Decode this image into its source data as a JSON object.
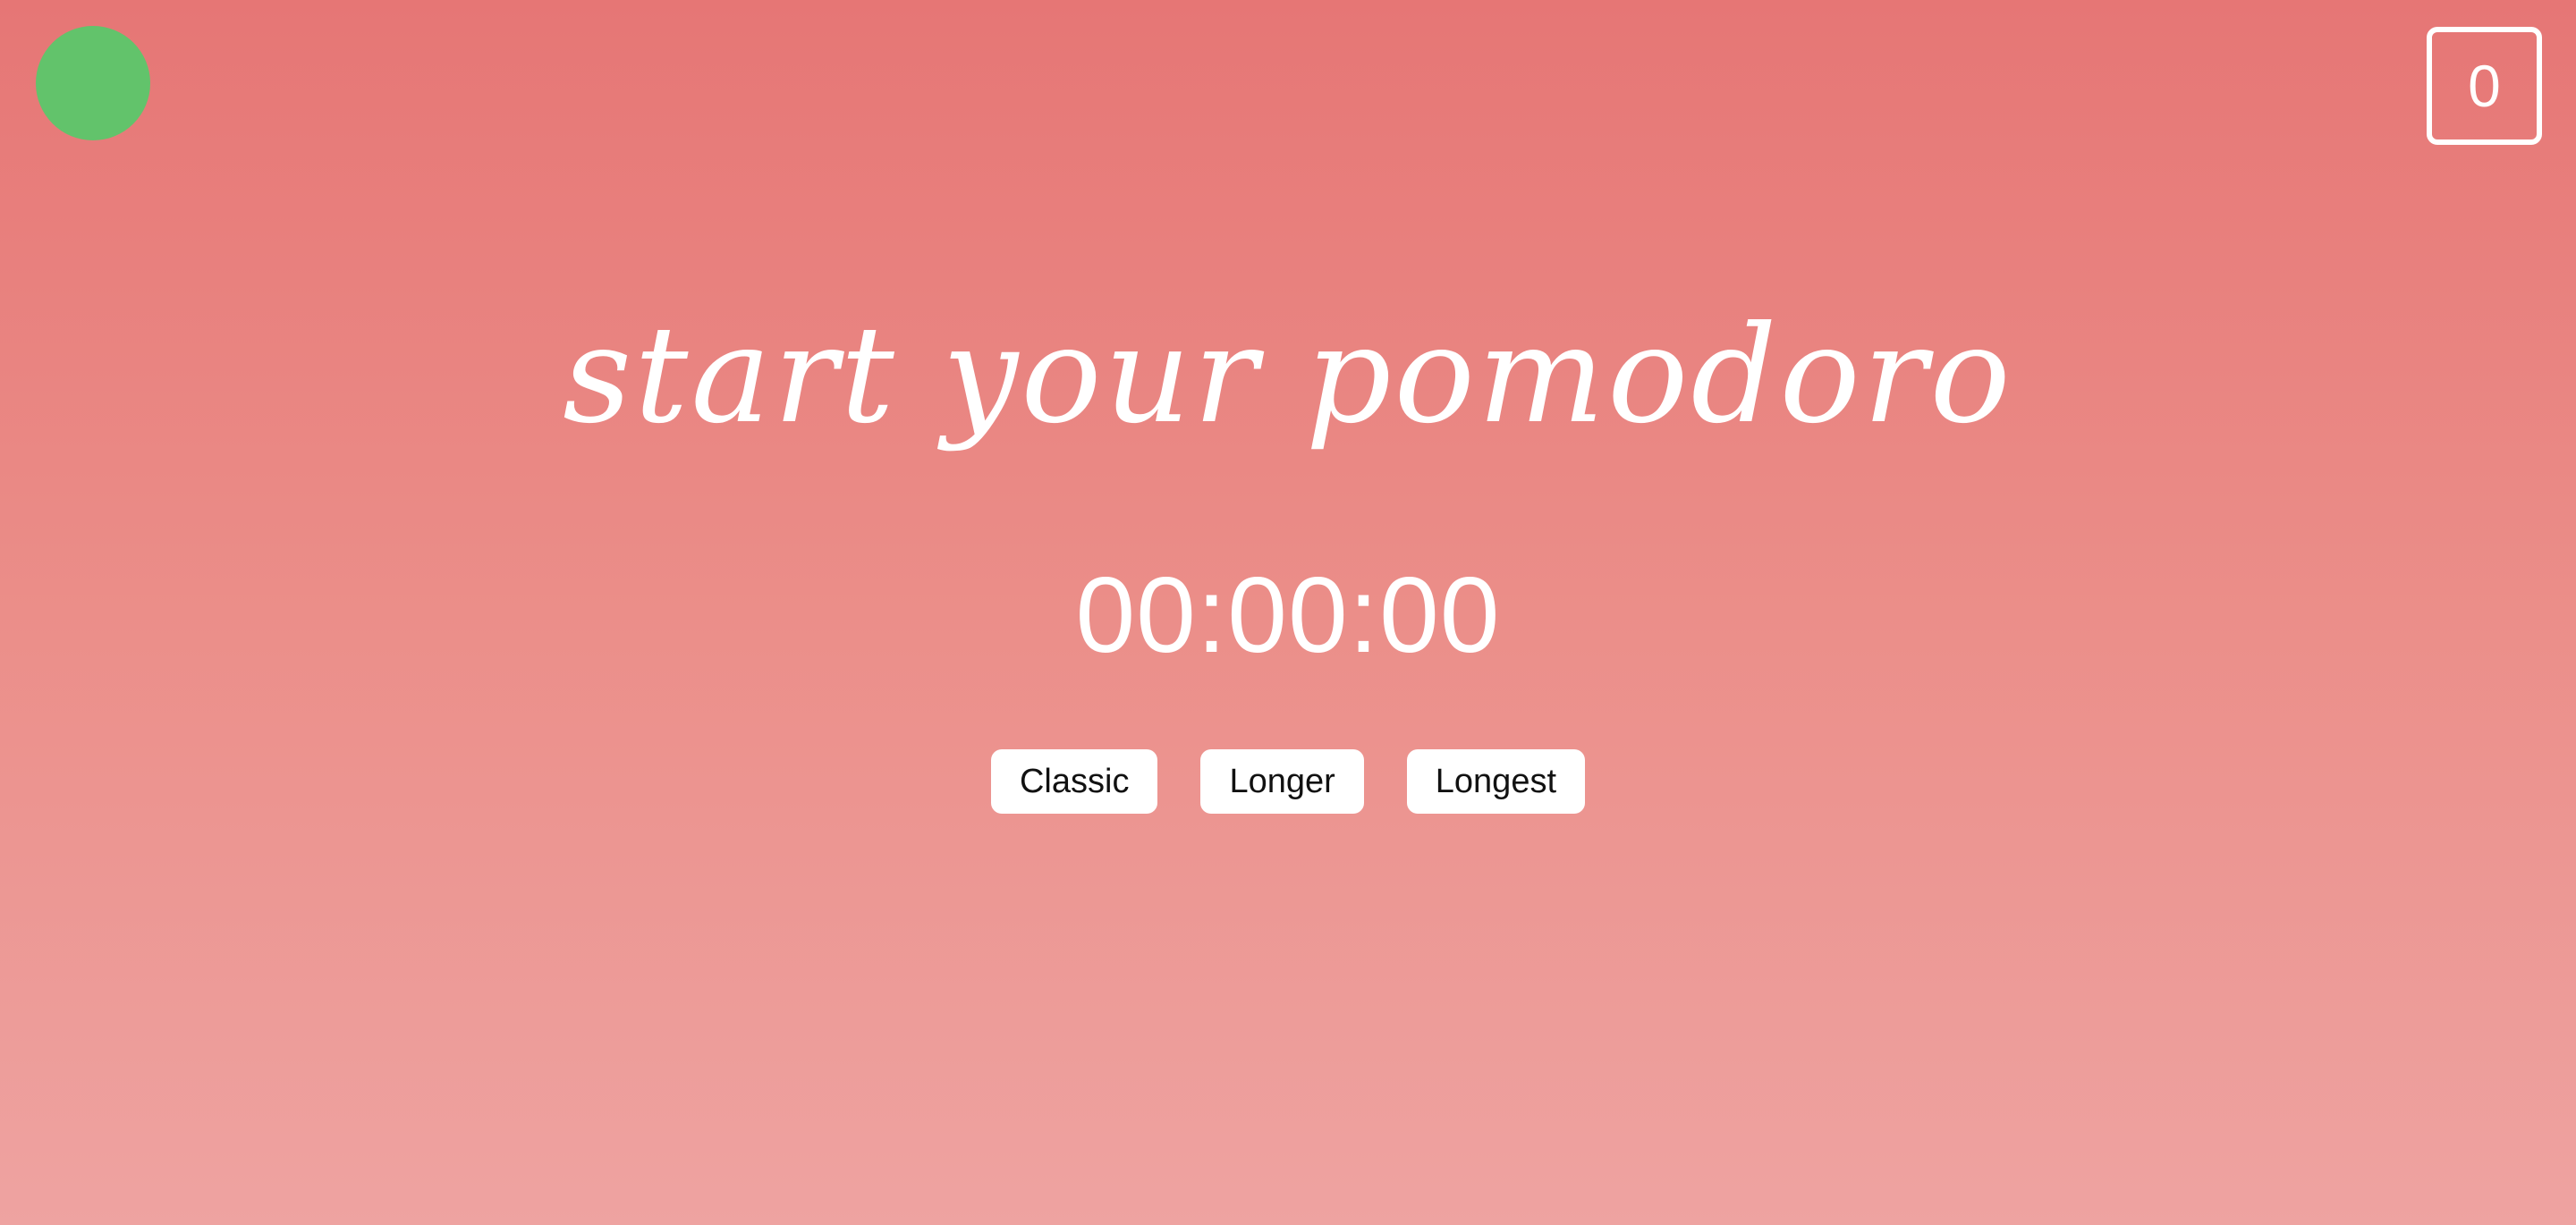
{
  "session_count": "0",
  "headline": "start your pomodoro",
  "timer": {
    "display": "00:00:00"
  },
  "modes": [
    {
      "label": "Classic"
    },
    {
      "label": "Longer"
    },
    {
      "label": "Longest"
    }
  ],
  "colors": {
    "background_top": "#e67675",
    "background_bottom": "#eea3a1",
    "status_dot": "#62c36b",
    "text": "#ffffff",
    "button_background": "#ffffff"
  }
}
